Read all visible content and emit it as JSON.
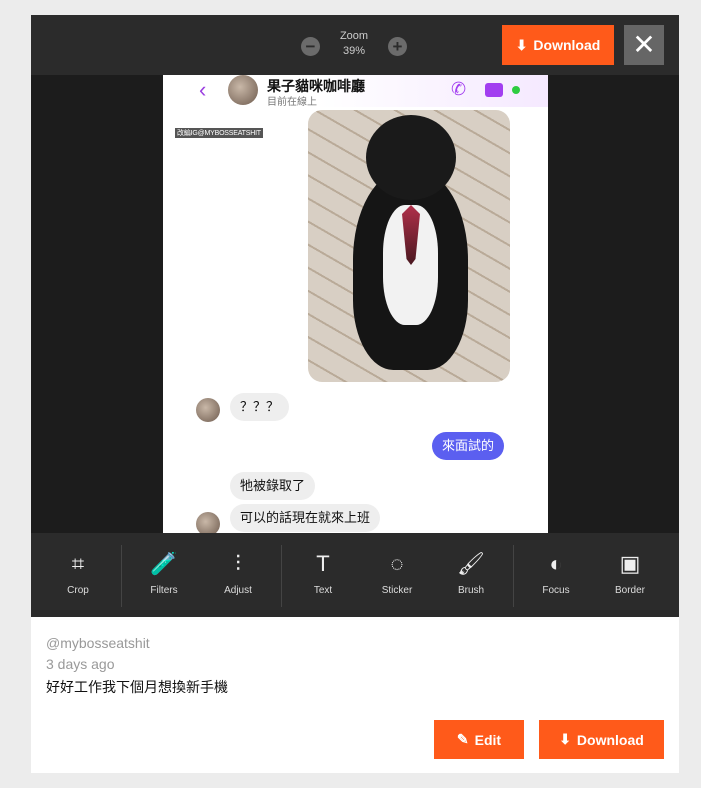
{
  "header": {
    "zoom_label": "Zoom",
    "zoom_value": "39%",
    "download_label": "Download",
    "close_icon": "close-icon"
  },
  "chat": {
    "title": "果子貓咪咖啡廳",
    "status": "目前在線上",
    "watermark": "改編IG@MYBOSSEATSHIT",
    "messages": [
      {
        "text": "？？？",
        "from": "other"
      },
      {
        "text": "來面試的",
        "from": "me"
      },
      {
        "text": "牠被錄取了",
        "from": "other"
      },
      {
        "text": "可以的話現在就來上班",
        "from": "other"
      }
    ],
    "accent": "#a23ef0",
    "bubble_color": "#5b5ff0"
  },
  "tools": [
    {
      "label": "Crop",
      "icon": "crop-icon"
    },
    {
      "label": "Filters",
      "icon": "filters-icon"
    },
    {
      "label": "Adjust",
      "icon": "adjust-icon"
    },
    {
      "label": "Text",
      "icon": "text-icon"
    },
    {
      "label": "Sticker",
      "icon": "sticker-icon"
    },
    {
      "label": "Brush",
      "icon": "brush-icon"
    },
    {
      "label": "Focus",
      "icon": "focus-icon"
    },
    {
      "label": "Border",
      "icon": "border-icon"
    }
  ],
  "post": {
    "username": "@mybosseatshit",
    "time": "3 days ago",
    "caption": "好好工作我下個月想換新手機",
    "edit_label": "Edit",
    "download_label": "Download"
  },
  "brand_color": "#ff5a1a"
}
